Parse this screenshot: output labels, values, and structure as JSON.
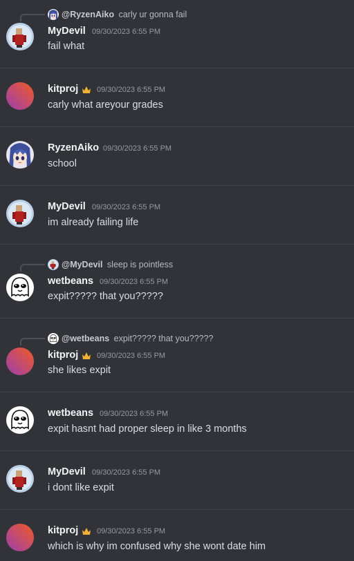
{
  "messages": [
    {
      "author": "MyDevil",
      "timestamp": "09/30/2023 6:55 PM",
      "text": "fail what",
      "reply": {
        "author": "@RyzenAiko",
        "text": "carly ur gonna fail"
      }
    },
    {
      "author": "kitproj",
      "timestamp": "09/30/2023 6:55 PM",
      "text": "carly what areyour grades",
      "badge": "crown-icon"
    },
    {
      "author": "RyzenAiko",
      "timestamp": "09/30/2023 6:55 PM",
      "text": "school"
    },
    {
      "author": "MyDevil",
      "timestamp": "09/30/2023 6:55 PM",
      "text": "im already failing life"
    },
    {
      "author": "wetbeans",
      "timestamp": "09/30/2023 6:55 PM",
      "text": "expit????? that you?????",
      "reply": {
        "author": "@MyDevil",
        "text": "sleep is pointless"
      }
    },
    {
      "author": "kitproj",
      "timestamp": "09/30/2023 6:55 PM",
      "text": "she likes expit",
      "badge": "crown-icon",
      "reply": {
        "author": "@wetbeans",
        "text": "expit????? that you?????"
      }
    },
    {
      "author": "wetbeans",
      "timestamp": "09/30/2023 6:55 PM",
      "text": "expit hasnt had proper sleep in like 3 months"
    },
    {
      "author": "MyDevil",
      "timestamp": "09/30/2023 6:55 PM",
      "text": "i dont like expit"
    },
    {
      "author": "kitproj",
      "timestamp": "09/30/2023 6:55 PM",
      "text": "which is why im confused why she wont date him",
      "badge": "crown-icon"
    }
  ],
  "colors": {
    "background": "#313338",
    "username": "#f2f3f5",
    "text": "#dbdee1",
    "timestamp": "#949ba4",
    "crown": "#f0b232",
    "kitproj_gradient_start": "#9b3fb0",
    "kitproj_gradient_end": "#f15a24"
  }
}
